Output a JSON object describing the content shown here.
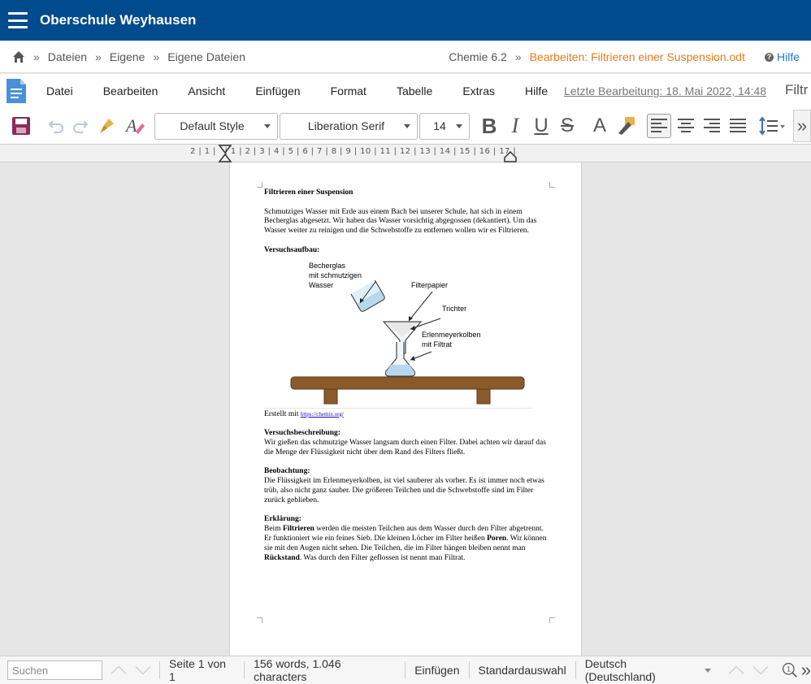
{
  "header": {
    "site_title": "Oberschule Weyhausen"
  },
  "breadcrumb": {
    "items": [
      "Dateien",
      "Eigene",
      "Eigene Dateien"
    ],
    "separator": "»",
    "folder": "Chemie 6.2",
    "editing": "Bearbeiten: Filtrieren einer Suspension.odt",
    "help": "Hilfe"
  },
  "menu": {
    "items": [
      "Datei",
      "Bearbeiten",
      "Ansicht",
      "Einfügen",
      "Format",
      "Tabelle",
      "Extras",
      "Hilfe"
    ],
    "last_edit": "Letzte Bearbeitung: 18. Mai 2022, 14:48",
    "doc_title_cut": "Filtr"
  },
  "toolbar": {
    "paragraph_style": "Default Style",
    "font_name": "Liberation Serif",
    "font_size": "14"
  },
  "ruler": {
    "marks": "2 | 1 |   | 1 | 2 | 3 | 4 | 5 | 6 | 7 | 8 | 9 | 10 | 11 | 12 | 13 | 14 | 15 | 16 | 17 |"
  },
  "document": {
    "title": "Filtrieren einer Suspension",
    "intro": "Schmutziges Wasser mit Erde aus einem Bach bei unserer Schule, hat sich in einem Becherglas abgesetzt. Wir haben das Wasser vorsichtig abgegossen (dekantiert). Um das Wasser weiter zu reinigen und die Schwebstoffe zu entfernen wollen wir es Filtrieren.",
    "setup_heading": "Versuchsaufbau:",
    "figure_labels": {
      "beaker": [
        "Becherglas",
        "mit schmutzigen",
        "Wasser"
      ],
      "filterpaper": "Filterpapier",
      "funnel": "Trichter",
      "flask": [
        "Erlenmeyerkolben",
        "mit Filtrat"
      ]
    },
    "credit_prefix": "Erstellt mit",
    "credit_link": "https://chemix.org/",
    "desc_heading": "Versuchsbeschreibung:",
    "desc": "Wir gießen das schmutzige Wasser langsam durch einen Filter. Dabei achten wir darauf das die Menge der Flüssigkeit nicht über dem Rand des Filters fließt.",
    "obs_heading": "Beobachtung:",
    "obs": "Die Flüssigkeit im Erlenmeyerkolben, ist viel sauberer als vorher. Es ist immer noch etwas trüb, also nicht ganz sauber. Die größeren Teilchen und die Schwebstoffe sind im Filter zurück geblieben.",
    "expl_heading": "Erklärung:",
    "expl": {
      "p1": "Beim ",
      "b1": "Filtrieren",
      "p2": " werden die meisten Teilchen aus dem Wasser durch den Filter abgetrennt. Er funktioniert wie ein feines Sieb. Die kleinen Löcher im Filter heißen ",
      "b2": "Poren",
      "p3": ". Wir können sie mit den Augen nicht sehen. Die Teilchen, die im Filter hängen bleiben nennt man ",
      "b3": "Rückstand",
      "p4": ". Was durch den Filter geflossen ist nennt man Filtrat."
    }
  },
  "status": {
    "search_placeholder": "Suchen",
    "page": "Seite 1 von 1",
    "counts": "156 words, 1.046 characters",
    "mode": "Einfügen",
    "selection": "Standardauswahl",
    "language": "Deutsch (Deutschland)"
  },
  "icons": [
    "menu-icon",
    "home-icon",
    "help-icon",
    "document-icon",
    "save-icon",
    "undo-icon",
    "redo-icon",
    "clone-formatting-icon",
    "clear-formatting-icon",
    "bold-icon",
    "italic-icon",
    "underline-icon",
    "strikethrough-icon",
    "font-color-icon",
    "highlight-icon",
    "align-left-icon",
    "align-center-icon",
    "align-right-icon",
    "justify-icon",
    "line-spacing-icon",
    "more-icon",
    "zoom-icon"
  ],
  "colors": {
    "header": "#004b8d",
    "accent": "#e47c1b",
    "link": "#1f78d1"
  }
}
